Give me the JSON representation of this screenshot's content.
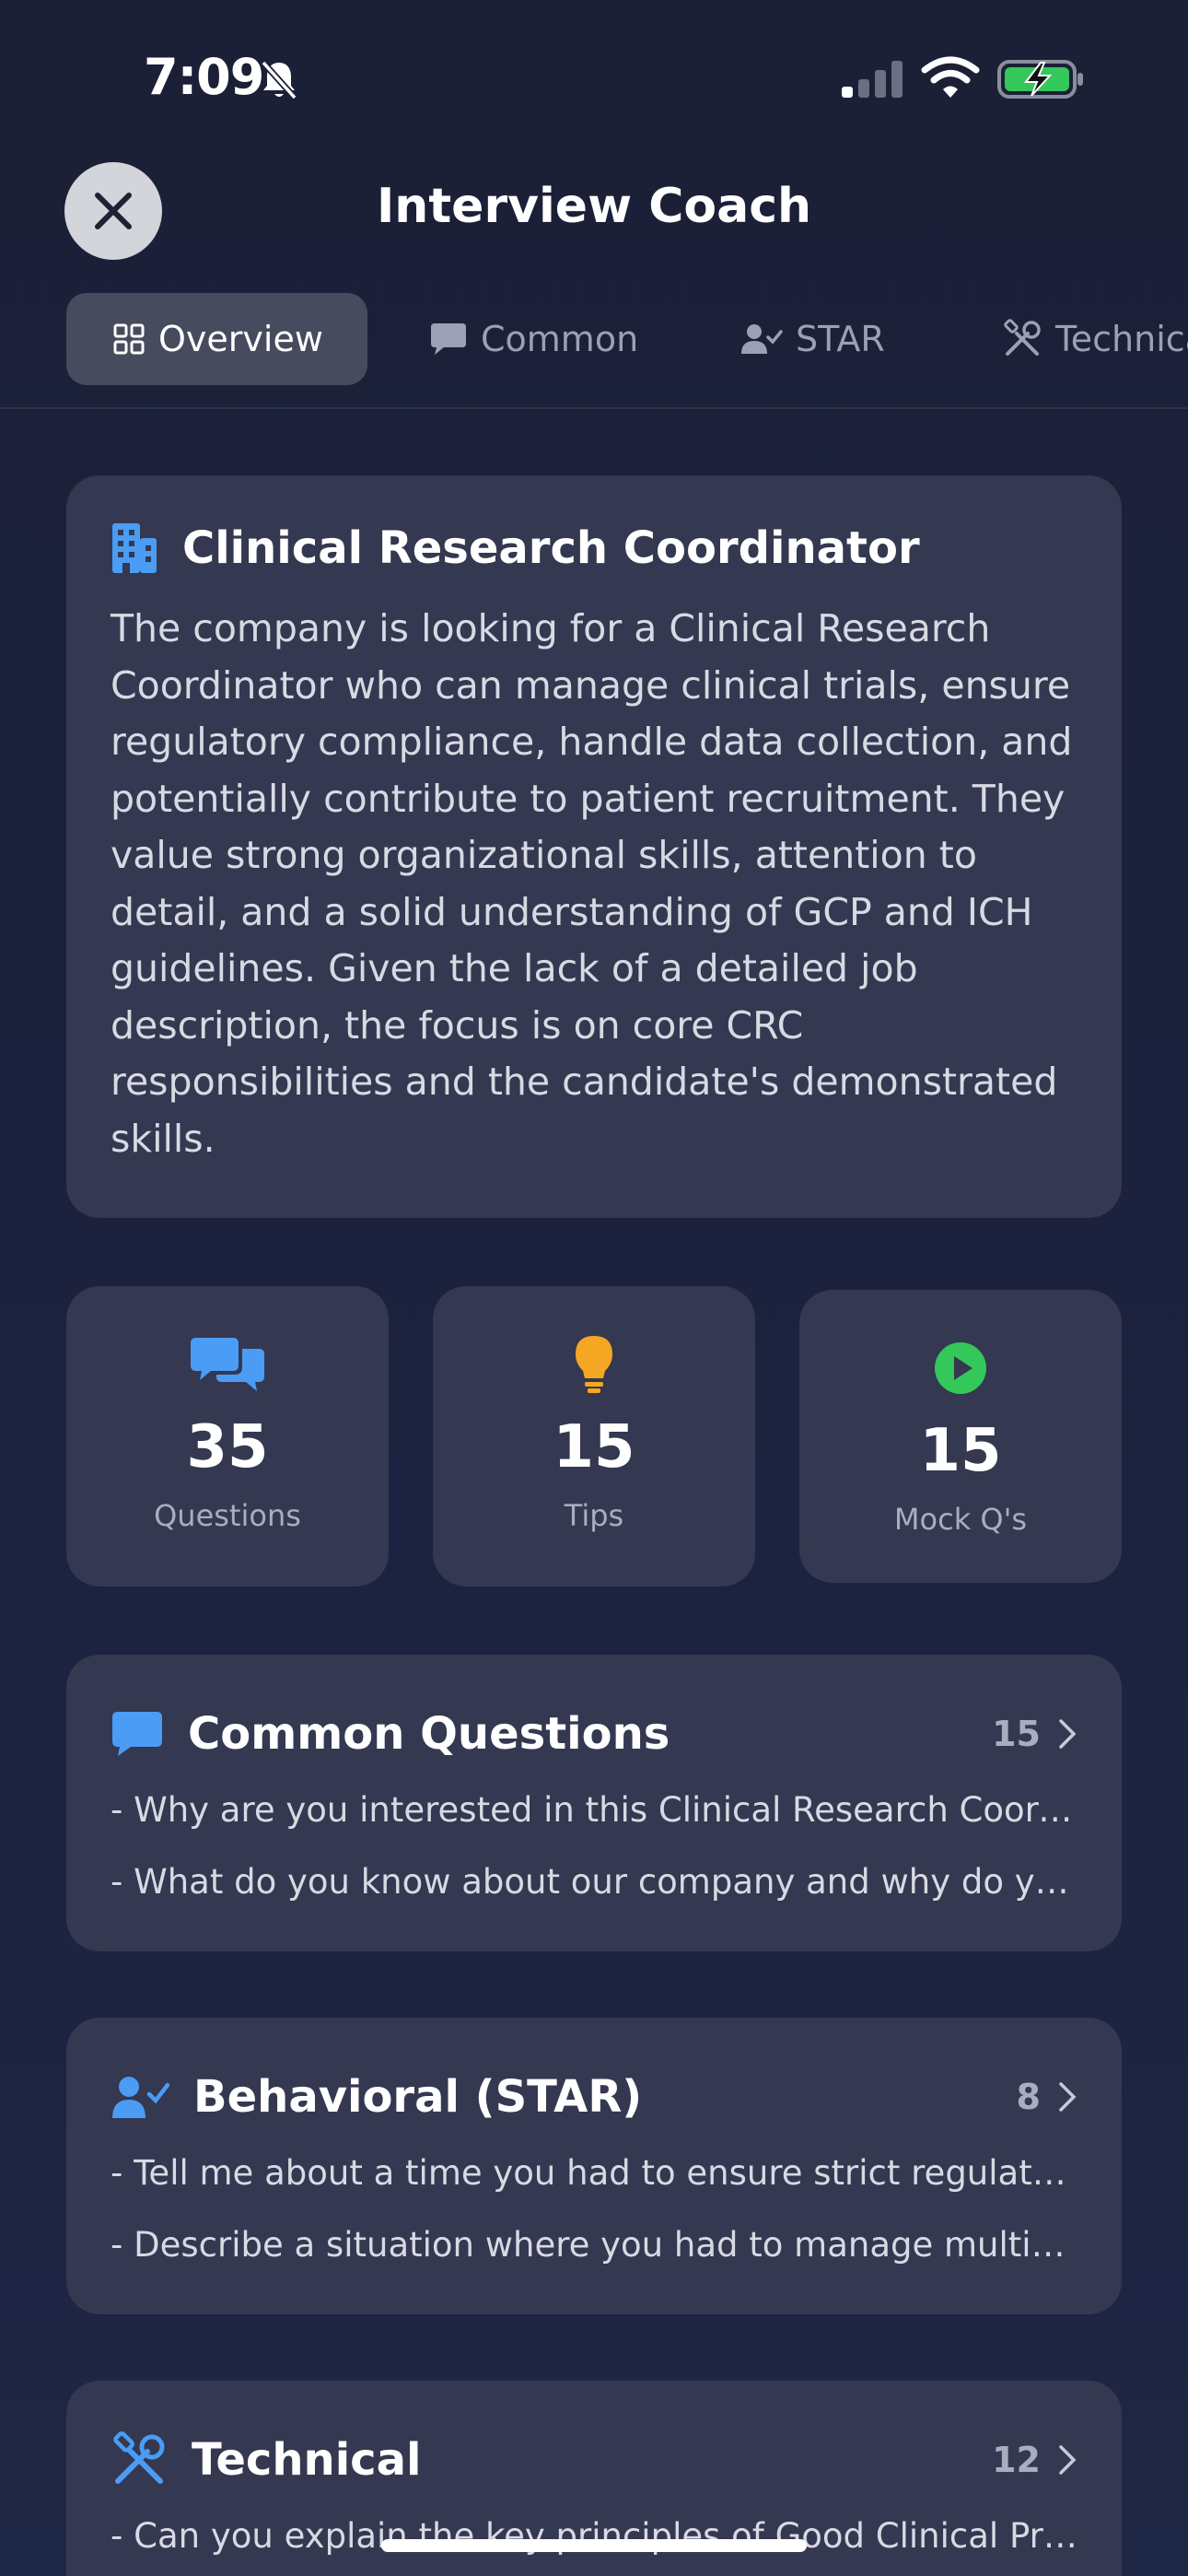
{
  "status_bar": {
    "time": "7:09"
  },
  "header": {
    "title": "Interview Coach"
  },
  "tabs": [
    {
      "label": "Overview",
      "icon": "grid-icon"
    },
    {
      "label": "Common",
      "icon": "chat-bubble-icon"
    },
    {
      "label": "STAR",
      "icon": "person-check-icon"
    },
    {
      "label": "Technical",
      "icon": "tools-icon"
    }
  ],
  "job": {
    "title": "Clinical Research Coordinator",
    "description": "The company is looking for a Clinical Research Coordinator who can manage clinical trials, ensure regulatory compliance, handle data collection, and potentially contribute to patient recruitment. They value strong organizational skills, attention to detail, and a solid understanding of GCP and ICH guidelines. Given the lack of a detailed job description, the focus is on core CRC responsibilities and the candidate's demonstrated skills."
  },
  "stats": [
    {
      "value": "35",
      "label": "Questions",
      "icon": "chat-bubbles-icon",
      "color": "#4a9cf5"
    },
    {
      "value": "15",
      "label": "Tips",
      "icon": "lightbulb-icon",
      "color": "#f5a623"
    },
    {
      "value": "15",
      "label": "Mock Q's",
      "icon": "play-circle-icon",
      "color": "#34c759"
    }
  ],
  "sections": [
    {
      "title": "Common Questions",
      "count": "15",
      "icon": "chat-bubble-icon",
      "items": [
        "- Why are you interested in this Clinical Research Coordinator role?",
        "- What do you know about our company and why do you want to work here?"
      ]
    },
    {
      "title": "Behavioral (STAR)",
      "count": "8",
      "icon": "person-check-icon",
      "items": [
        "- Tell me about a time you had to ensure strict regulatory compliance.",
        "- Describe a situation where you had to manage multiple priorities."
      ]
    },
    {
      "title": "Technical",
      "count": "12",
      "icon": "tools-icon",
      "items": [
        "- Can you explain the key principles of Good Clinical Practice?"
      ]
    }
  ],
  "colors": {
    "accent": "#4a9cf5",
    "card": "#343850",
    "background": "#1b2036"
  }
}
